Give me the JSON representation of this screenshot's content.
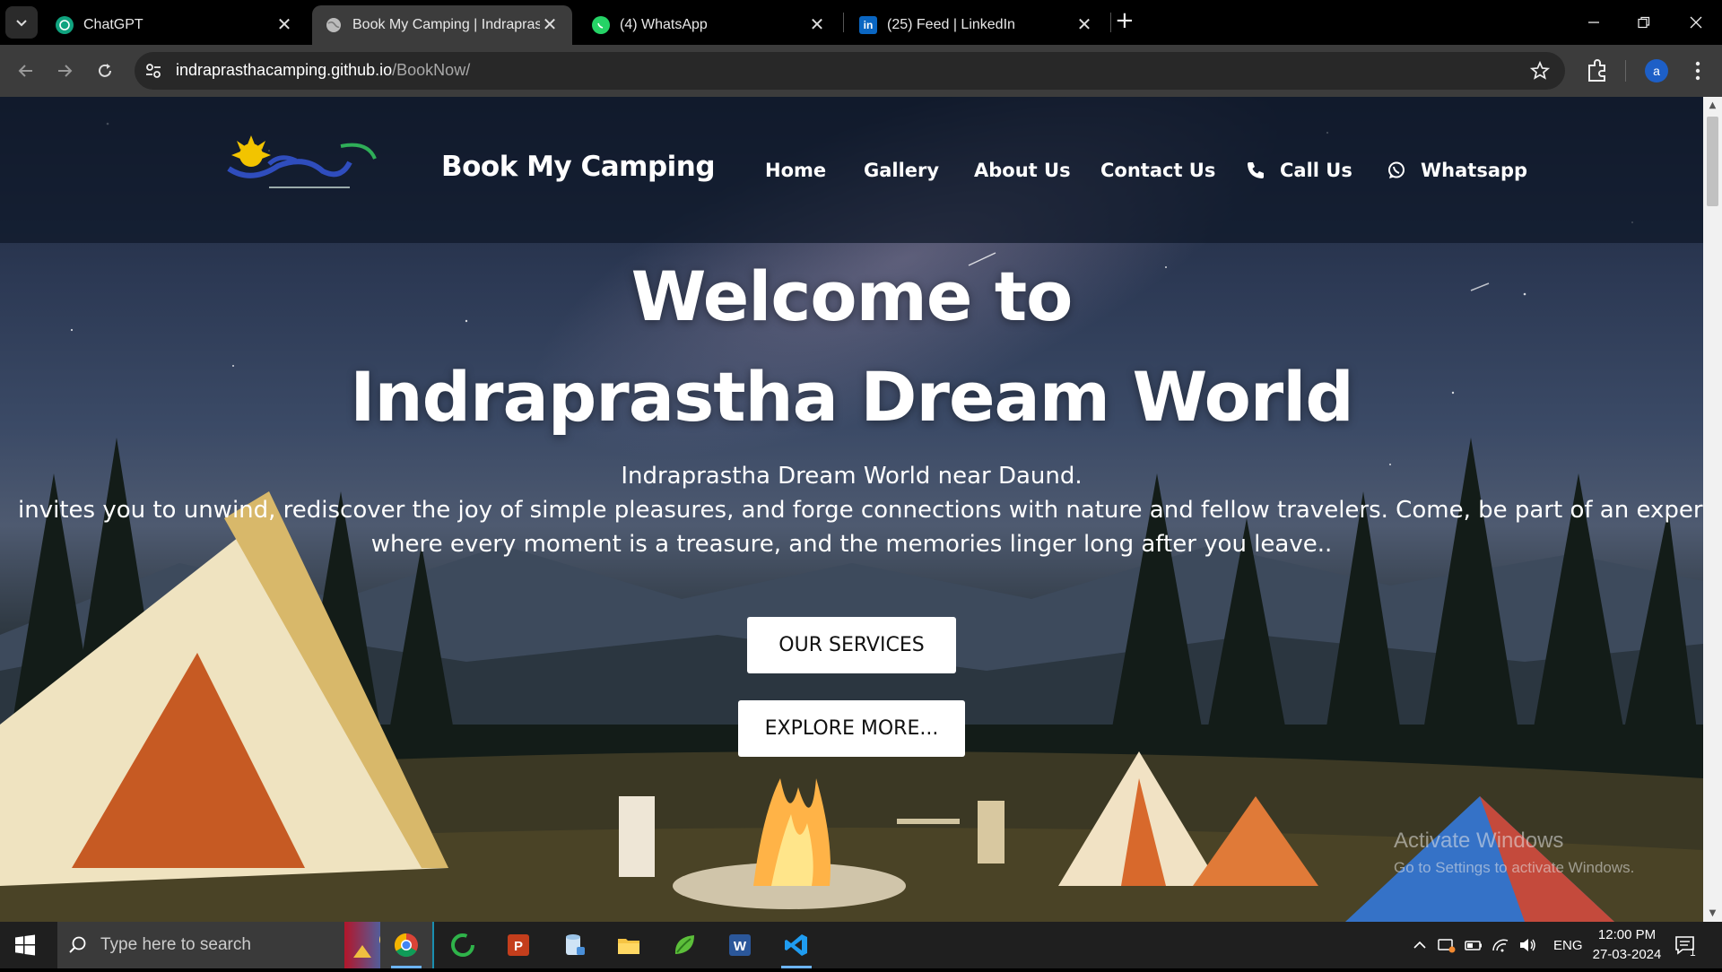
{
  "browser": {
    "tabs": [
      {
        "title": "ChatGPT",
        "icon": "chatgpt-icon"
      },
      {
        "title": "Book My Camping | Indraprastha",
        "icon": "globe-icon",
        "active": true
      },
      {
        "title": "(4) WhatsApp",
        "icon": "whatsapp-icon"
      },
      {
        "title": "(25) Feed | LinkedIn",
        "icon": "linkedin-icon"
      }
    ],
    "address": {
      "host": "indraprasthacamping.github.io",
      "path": "/BookNow/"
    },
    "profile_initial": "a"
  },
  "site": {
    "brand": "Book My Camping",
    "nav": [
      {
        "label": "Home"
      },
      {
        "label": "Gallery"
      },
      {
        "label": "About Us"
      },
      {
        "label": "Contact Us"
      },
      {
        "label": "Call Us",
        "icon": "phone-icon"
      },
      {
        "label": "Whatsapp",
        "icon": "whatsapp-icon"
      }
    ],
    "hero": {
      "line1": "Welcome to",
      "line2": "Indraprastha Dream World",
      "sub1": "Indraprastha Dream World near Daund.",
      "sub2": "invites you to unwind, rediscover the joy of simple pleasures, and forge connections with nature and fellow travelers. Come, be part of an experience",
      "sub3": "where every moment is a treasure, and the memories linger long after you leave..",
      "button_services": "OUR SERVICES",
      "button_explore": "EXPLORE MORE..."
    }
  },
  "watermark": {
    "title": "Activate Windows",
    "subtitle": "Go to Settings to activate Windows."
  },
  "taskbar": {
    "search_placeholder": "Type here to search",
    "language": "ENG",
    "time": "12:00 PM",
    "date": "27-03-2024",
    "notification_count": "1"
  },
  "colors": {
    "accent": "#6cb4ff",
    "nav_bg": "#0e1828",
    "button_bg": "#ffffff"
  }
}
